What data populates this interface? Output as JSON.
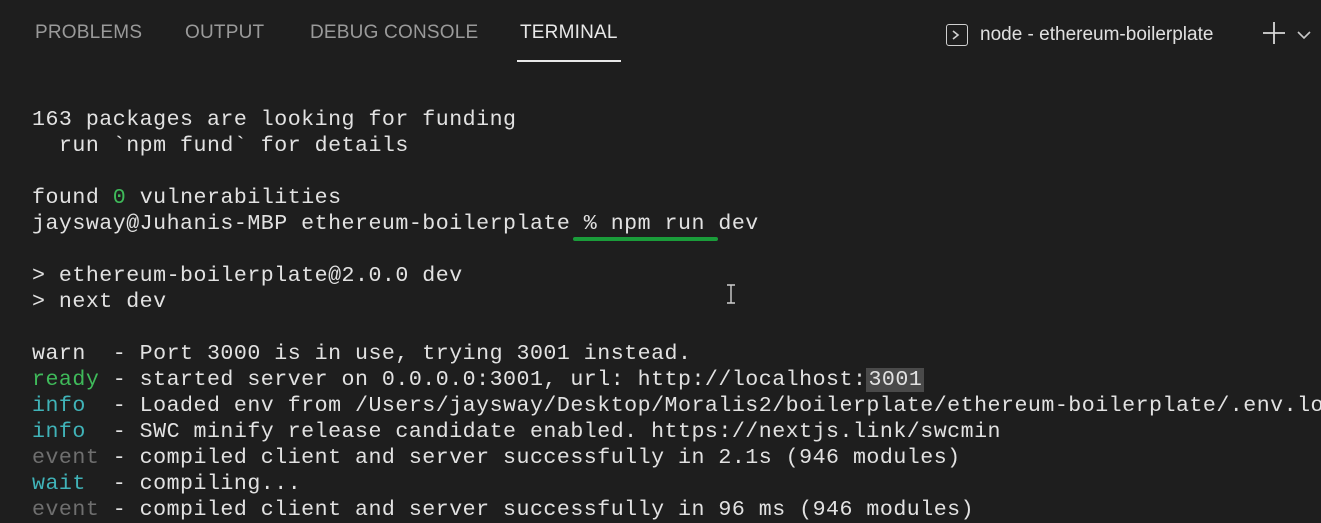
{
  "tabs": [
    {
      "label": "PROBLEMS"
    },
    {
      "label": "OUTPUT"
    },
    {
      "label": "DEBUG CONSOLE"
    },
    {
      "label": "TERMINAL"
    }
  ],
  "active_tab": "TERMINAL",
  "terminal_selector": {
    "label": "node - ethereum-boilerplate"
  },
  "icons": {
    "terminal": "terminal-icon",
    "plus": "plus-icon",
    "chevron": "chevron-down-icon",
    "cursor": "text-cursor-icon"
  },
  "colors": {
    "background": "#1e1e1e",
    "green": "#3fba5a",
    "cyan": "#40b3b8",
    "dim": "#6f6f6f",
    "underline": "#1a9c3a"
  },
  "terminal": {
    "l1": "163 packages are looking for funding",
    "l2": "  run `npm fund` for details",
    "l3_a": "found ",
    "l3_b": "0",
    "l3_c": " vulnerabilities",
    "l4_prompt": "jaysway@Juhanis-MBP ethereum-boilerplate % ",
    "l4_cmd": "npm run dev",
    "l5": "> ethereum-boilerplate@2.0.0 dev",
    "l6": "> next dev",
    "l7_tag": "warn ",
    "l7_msg": " - Port 3000 is in use, trying 3001 instead.",
    "l8_tag": "ready",
    "l8_msg": " - started server on 0.0.0.0:3001, url: http://localhost:",
    "l8_sel": "3001",
    "l9_tag": "info ",
    "l9_msg": " - Loaded env from /Users/jaysway/Desktop/Moralis2/boilerplate/ethereum-boilerplate/.env.local",
    "l10_tag": "info ",
    "l10_msg": " - SWC minify release candidate enabled. https://nextjs.link/swcmin",
    "l11_tag": "event",
    "l11_msg": " - compiled client and server successfully in 2.1s (946 modules)",
    "l12_tag": "wait ",
    "l12_msg": " - compiling...",
    "l13_tag": "event",
    "l13_msg": " - compiled client and server successfully in 96 ms (946 modules)"
  }
}
